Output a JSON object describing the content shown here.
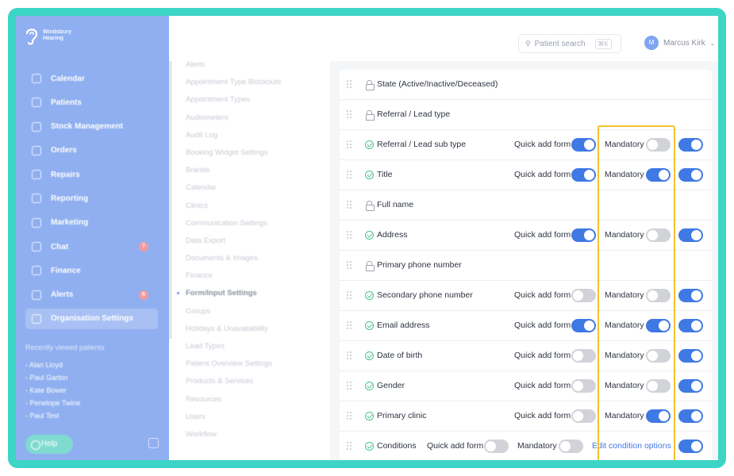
{
  "brand": {
    "line1": "Windsbury",
    "line2": "Hearing"
  },
  "sidebar": {
    "items": [
      {
        "label": "Calendar",
        "icon": "calendar-icon"
      },
      {
        "label": "Patients",
        "icon": "patients-icon"
      },
      {
        "label": "Stock Management",
        "icon": "stock-icon"
      },
      {
        "label": "Orders",
        "icon": "orders-icon"
      },
      {
        "label": "Repairs",
        "icon": "wrench-icon"
      },
      {
        "label": "Reporting",
        "icon": "chart-icon"
      },
      {
        "label": "Marketing",
        "icon": "mail-icon"
      },
      {
        "label": "Chat",
        "icon": "chat-icon",
        "badge": "7"
      },
      {
        "label": "Finance",
        "icon": "card-icon"
      },
      {
        "label": "Alerts",
        "icon": "bell-icon",
        "badge": "6"
      },
      {
        "label": "Organisation Settings",
        "icon": "gear-icon",
        "active": true
      }
    ],
    "recent_title": "Recently viewed patients",
    "recent": [
      "- Alan Lloyd",
      "- Paul Garton",
      "- Kate Bower",
      "- Penelope Twine",
      "- Paul Test"
    ],
    "help_label": "Help"
  },
  "topbar": {
    "search_label": "Patient search",
    "search_shortcut": "⌘K",
    "user_initial": "M",
    "user_name": "Marcus Kirk"
  },
  "settings_menu": [
    "Alerts",
    "Appointment Type Blockouts",
    "Appointment Types",
    "Audiometers",
    "Audit Log",
    "Booking Widget Settings",
    "Brands",
    "Calendar",
    "Clinics",
    "Communication Settings",
    "Data Export",
    "Documents & Images",
    "Finance",
    "Form/Input Settings",
    "Groups",
    "Holidays & Unavailability",
    "Lead Types",
    "Patient Overview Settings",
    "Products & Services",
    "Resources",
    "Users",
    "Workflow"
  ],
  "settings_menu_active": "Form/Input Settings",
  "labels": {
    "quick_add": "Quick add form",
    "mandatory": "Mandatory",
    "edit_conditions": "Edit condition options"
  },
  "fields": [
    {
      "label": "State (Active/Inactive/Deceased)",
      "locked": true
    },
    {
      "label": "Referral / Lead type",
      "locked": true
    },
    {
      "label": "Referral / Lead sub type",
      "locked": false,
      "quick_add": true,
      "mandatory": false,
      "enabled": true
    },
    {
      "label": "Title",
      "locked": false,
      "quick_add": true,
      "mandatory": true,
      "enabled": true
    },
    {
      "label": "Full name",
      "locked": true
    },
    {
      "label": "Address",
      "locked": false,
      "quick_add": true,
      "mandatory": false,
      "enabled": true
    },
    {
      "label": "Primary phone number",
      "locked": true
    },
    {
      "label": "Secondary phone number",
      "locked": false,
      "quick_add": false,
      "mandatory": false,
      "enabled": true
    },
    {
      "label": "Email address",
      "locked": false,
      "quick_add": true,
      "mandatory": true,
      "enabled": true
    },
    {
      "label": "Date of birth",
      "locked": false,
      "quick_add": false,
      "mandatory": false,
      "enabled": true
    },
    {
      "label": "Gender",
      "locked": false,
      "quick_add": false,
      "mandatory": false,
      "enabled": true
    },
    {
      "label": "Primary clinic",
      "locked": false,
      "quick_add": false,
      "mandatory": true,
      "enabled": true
    },
    {
      "label": "Conditions",
      "locked": false,
      "quick_add": false,
      "mandatory": false,
      "enabled": true,
      "edit_link": true
    }
  ],
  "colors": {
    "accent": "#3f79e4",
    "frame": "#3dd5c5",
    "sidebar": "#8faff0",
    "highlight": "#f2c230",
    "check": "#4cc48a"
  }
}
